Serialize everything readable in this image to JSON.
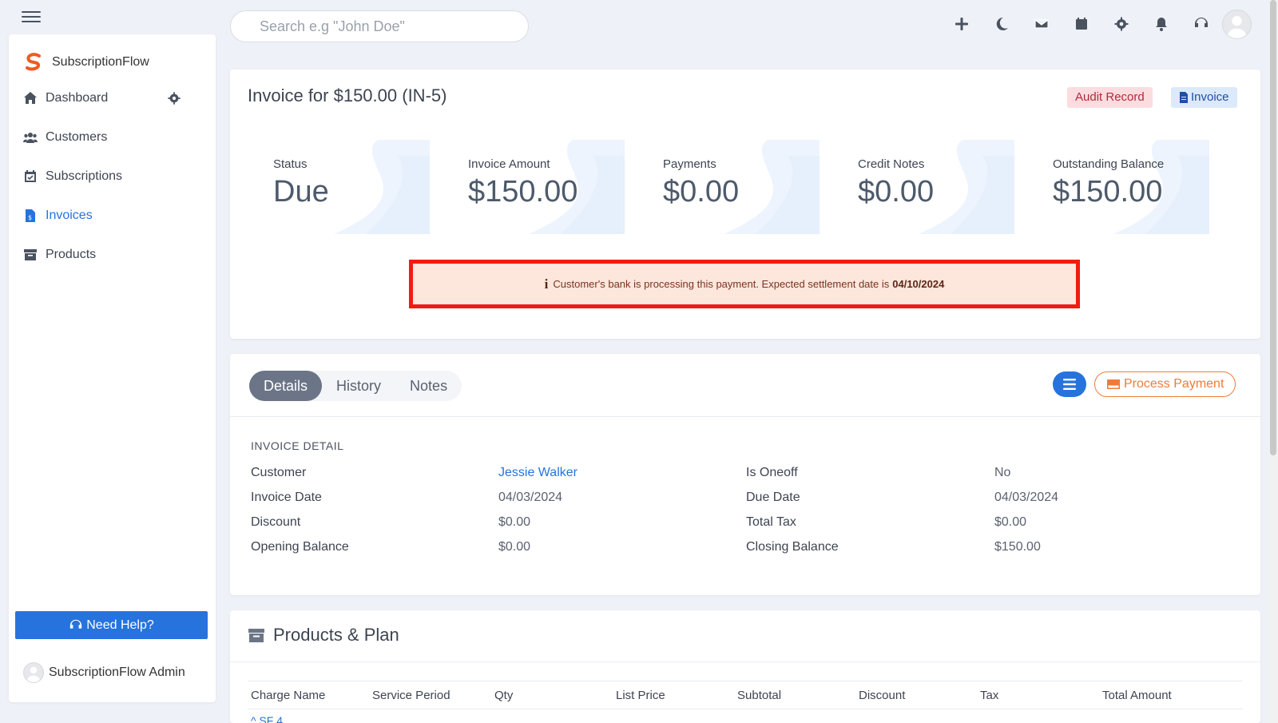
{
  "header": {
    "search_placeholder": "Search e.g \"John Doe\"",
    "icons": [
      "plus-icon",
      "moon-icon",
      "envelope-icon",
      "calendar-icon",
      "gear-icon",
      "bell-icon",
      "headset-icon"
    ]
  },
  "sidebar": {
    "brand": "SubscriptionFlow",
    "items": [
      {
        "label": "Dashboard",
        "icon": "home-icon"
      },
      {
        "label": "Customers",
        "icon": "users-icon"
      },
      {
        "label": "Subscriptions",
        "icon": "calendar-check-icon"
      },
      {
        "label": "Invoices",
        "icon": "invoice-icon"
      },
      {
        "label": "Products",
        "icon": "archive-icon"
      }
    ],
    "help_label": "Need Help?",
    "admin_name": "SubscriptionFlow Admin"
  },
  "invoice": {
    "title": "Invoice for $150.00 (IN-5)",
    "audit_label": "Audit Record",
    "invoice_label": "Invoice",
    "stats": [
      {
        "label": "Status",
        "value": "Due"
      },
      {
        "label": "Invoice Amount",
        "value": "$150.00"
      },
      {
        "label": "Payments",
        "value": "$0.00"
      },
      {
        "label": "Credit Notes",
        "value": "$0.00"
      },
      {
        "label": "Outstanding Balance",
        "value": "$150.00"
      }
    ],
    "alert_text": "Customer's bank is processing this payment. Expected settlement date is",
    "alert_date": "04/10/2024"
  },
  "details": {
    "tabs": [
      "Details",
      "History",
      "Notes"
    ],
    "process_label": "Process Payment",
    "section_title": "INVOICE DETAIL",
    "left": [
      {
        "label": "Customer",
        "value": "Jessie Walker"
      },
      {
        "label": "Invoice Date",
        "value": "04/03/2024"
      },
      {
        "label": "Discount",
        "value": "$0.00"
      },
      {
        "label": "Opening Balance",
        "value": "$0.00"
      }
    ],
    "right": [
      {
        "label": "Is Oneoff",
        "value": "No"
      },
      {
        "label": "Due Date",
        "value": "04/03/2024"
      },
      {
        "label": "Total Tax",
        "value": "$0.00"
      },
      {
        "label": "Closing Balance",
        "value": "$150.00"
      }
    ]
  },
  "products": {
    "title": "Products & Plan",
    "columns": [
      "Charge Name",
      "Service Period",
      "Qty",
      "List Price",
      "Subtotal",
      "Discount",
      "Tax",
      "Total Amount"
    ],
    "first_row_label": "SF 4"
  },
  "colors": {
    "accent": "#2673dd",
    "alert_border": "#f21b10",
    "alert_bg": "#fde6dc",
    "process_orange": "#f07a3a"
  }
}
